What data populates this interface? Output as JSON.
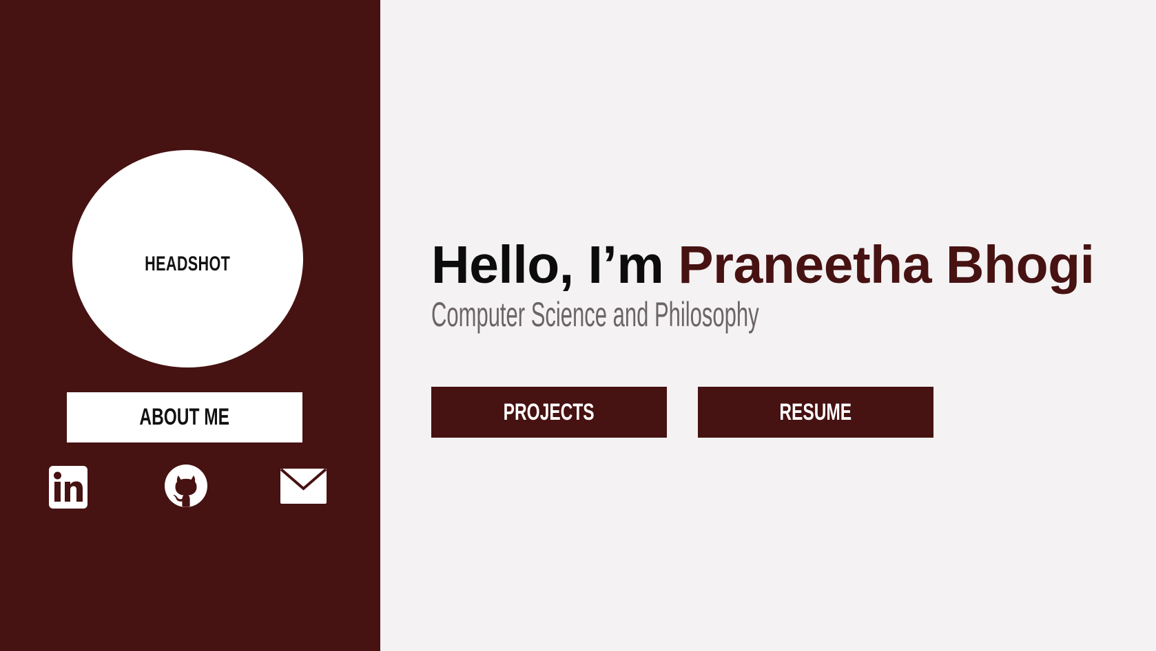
{
  "sidebar": {
    "headshot_label": "HEADSHOT",
    "about_label": "ABOUT ME",
    "social": [
      {
        "icon": "linkedin-icon"
      },
      {
        "icon": "github-icon"
      },
      {
        "icon": "mail-icon"
      }
    ]
  },
  "hero": {
    "greeting": "Hello, I’m",
    "name": "Praneetha Bhogi",
    "subtitle": "Computer Science and Philosophy"
  },
  "buttons": {
    "projects_label": "PROJECTS",
    "resume_label": "RESUME"
  },
  "colors": {
    "brand": "#471212",
    "background": "#f4f2f3",
    "subtitle": "#6b6466"
  }
}
